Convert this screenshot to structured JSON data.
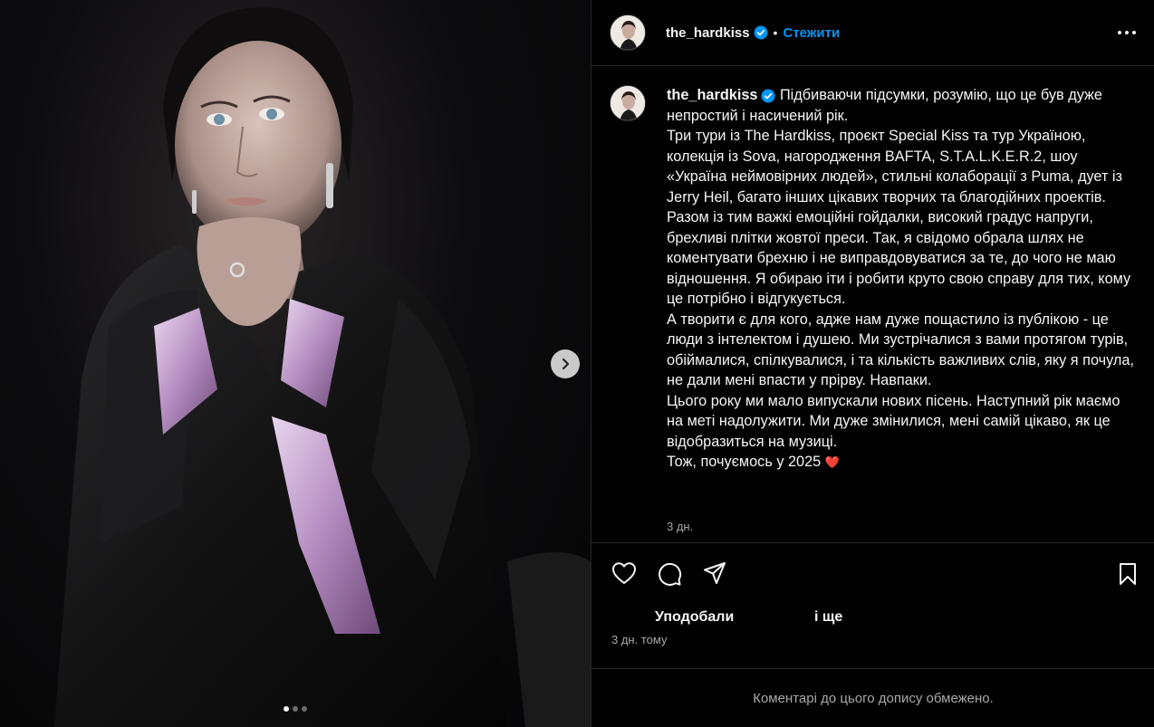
{
  "account": {
    "username": "the_hardkiss",
    "follow_label": "Стежити"
  },
  "caption": {
    "username": "the_hardkiss",
    "text": "Підбиваючи підсумки, розумію, що це був дуже непростий і насичений рік.\nТри тури із The Hardkiss, проєкт Special Kiss та тур Україною, колекція із Sova, нагородження BAFTA, S.T.A.L.K.E.R.2, шоу «Україна неймовірних людей», стильні колаборації з Puma, дует із Jerry Heil, багато інших цікавих творчих та благодійних проектів.\nРазом із тим важкі емоційні гойдалки, високий градус напруги, брехливі плітки жовтої преси. Так, я свідомо обрала шлях не коментувати брехню і не виправдовуватися за те, до чого не маю відношення. Я обираю іти і робити круто свою справу для тих, кому це потрібно і відгукується.\nА творити є для кого, адже нам дуже пощастило із публікою - це люди з інтелектом і душею. Ми зустрічалися з вами протягом турів, обіймалися, спілкувалися, і та кількість важливих слів, яку я почула, не дали мені впасти у прірву. Навпаки.\nЦього року ми мало випускали нових пісень. Наступний рік маємо на меті надолужити. Ми дуже змінилися, мені самій цікаво, як це відобразиться на музиці.\nТож, почуємось у 2025",
    "emoji": "❤️",
    "time": "3 дн."
  },
  "likes": {
    "prefix": "Уподобали",
    "suffix": "і ще"
  },
  "post_time": "3 дн. тому",
  "comments_note": "Коментарі до цього допису обмежено.",
  "carousel": {
    "current": 1,
    "total": 3
  },
  "icons": {
    "like": "heart-icon",
    "comment": "comment-icon",
    "share": "share-icon",
    "save": "bookmark-icon",
    "more": "more-horizontal-icon",
    "next": "chevron-right-icon",
    "verified": "verified-badge-icon"
  },
  "colors": {
    "accent": "#0095f6",
    "background": "#000000",
    "muted": "#a8a8a8",
    "heart": "#ff3040"
  }
}
